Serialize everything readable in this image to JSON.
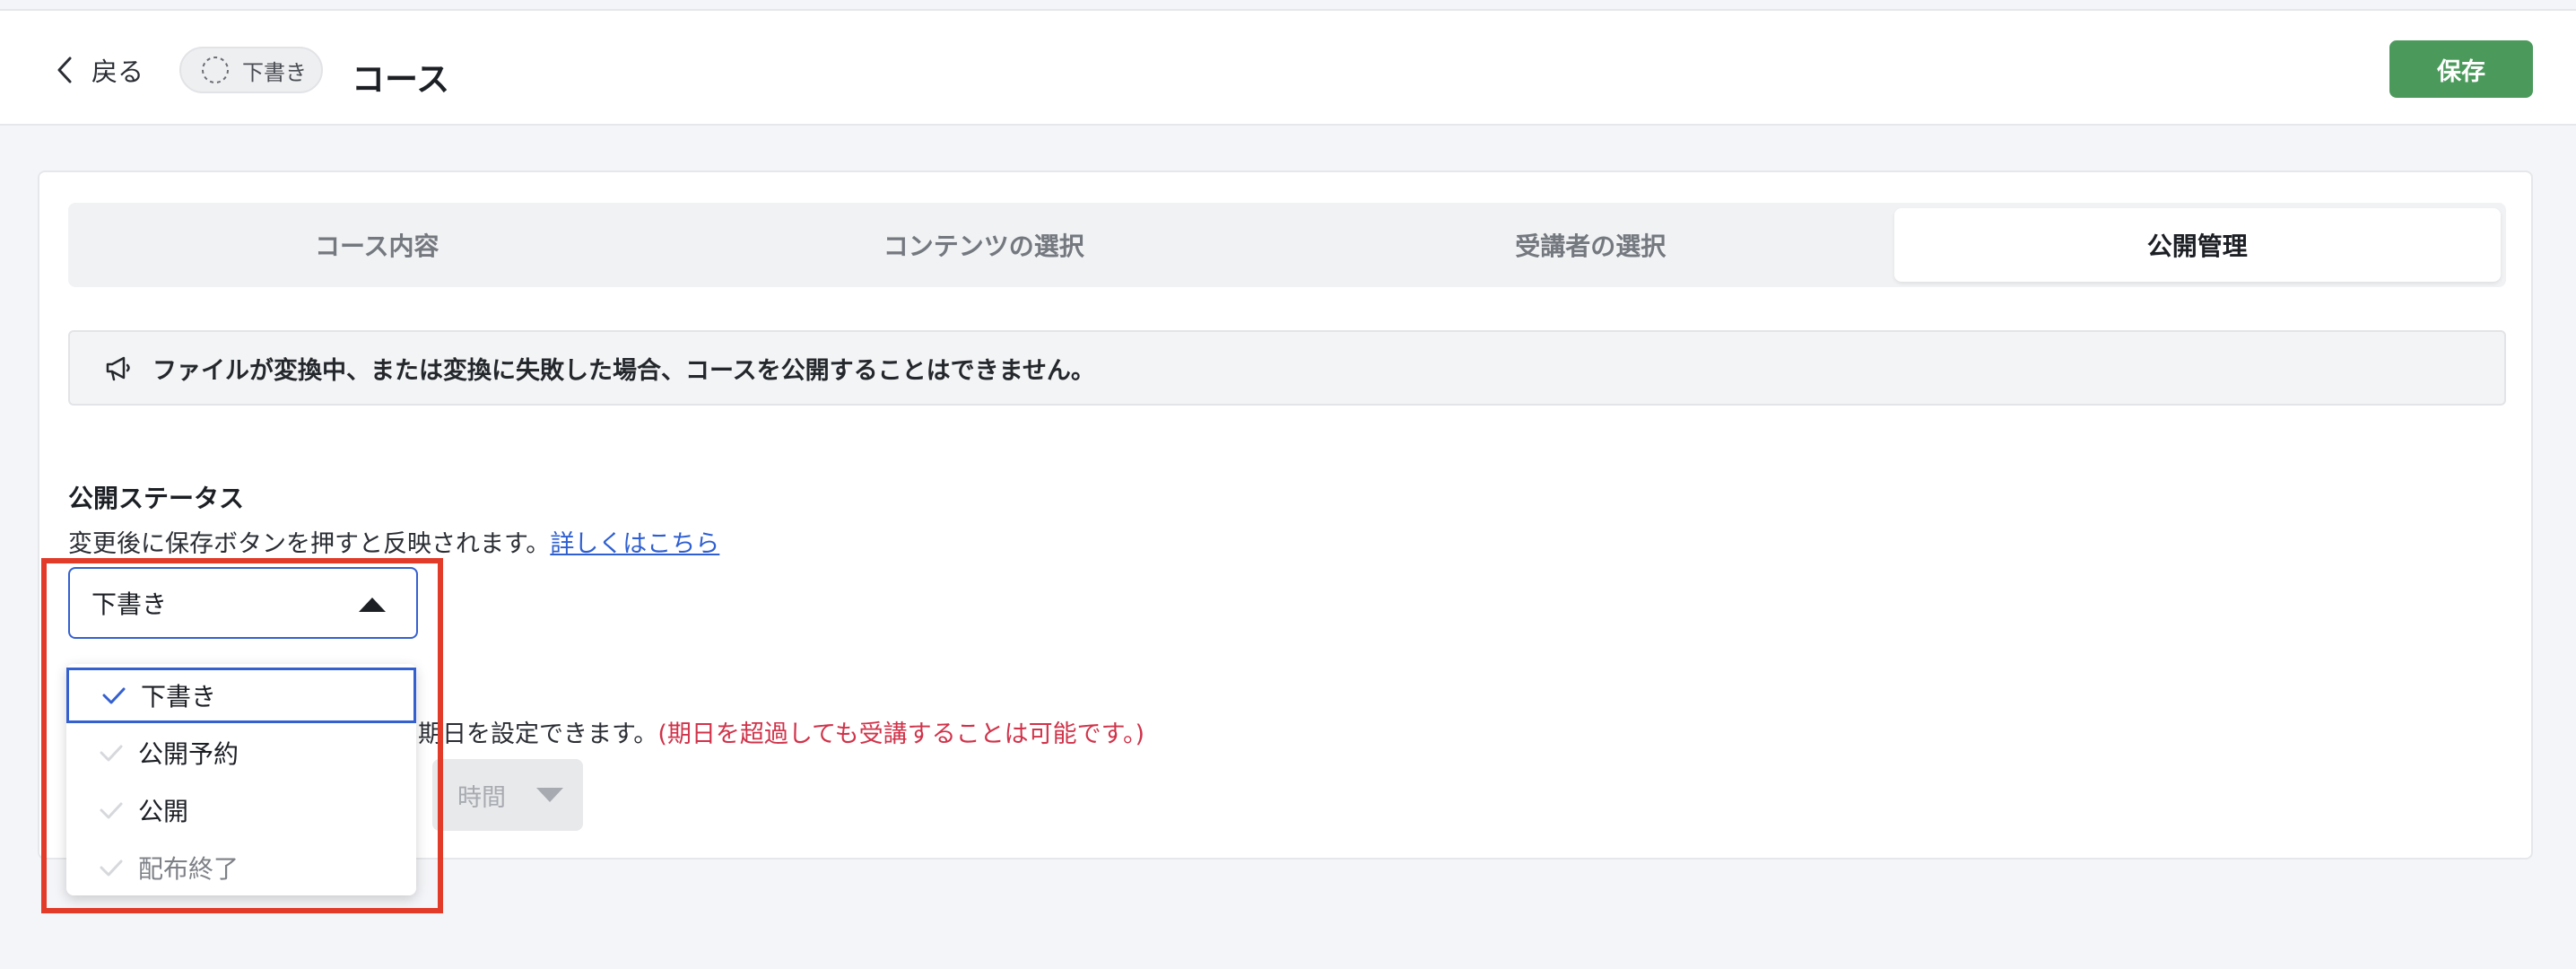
{
  "header": {
    "back_label": "戻る",
    "status_badge": "下書き",
    "title": "コース",
    "save_label": "保存"
  },
  "tabs": [
    {
      "label": "コース内容"
    },
    {
      "label": "コンテンツの選択"
    },
    {
      "label": "受講者の選択"
    },
    {
      "label": "公開管理"
    }
  ],
  "notice": {
    "text": "ファイルが変換中、または変換に失敗した場合、コースを公開することはできません。"
  },
  "publish": {
    "title": "公開ステータス",
    "desc": "変更後に保存ボタンを押すと反映されます。",
    "link": "詳しくはこちら",
    "selected": "下書き"
  },
  "deadline": {
    "desc": "期日を設定できます。",
    "warning": "(期日を超過しても受講することは可能です。)",
    "time_placeholder": "時間"
  },
  "dropdown": {
    "options": [
      {
        "label": "下書き"
      },
      {
        "label": "公開予約"
      },
      {
        "label": "公開"
      },
      {
        "label": "配布終了"
      }
    ]
  },
  "colors": {
    "accent": "#3560d0",
    "save": "#4b9a5c",
    "warning": "#d0334a",
    "highlight": "#e23b2a"
  }
}
